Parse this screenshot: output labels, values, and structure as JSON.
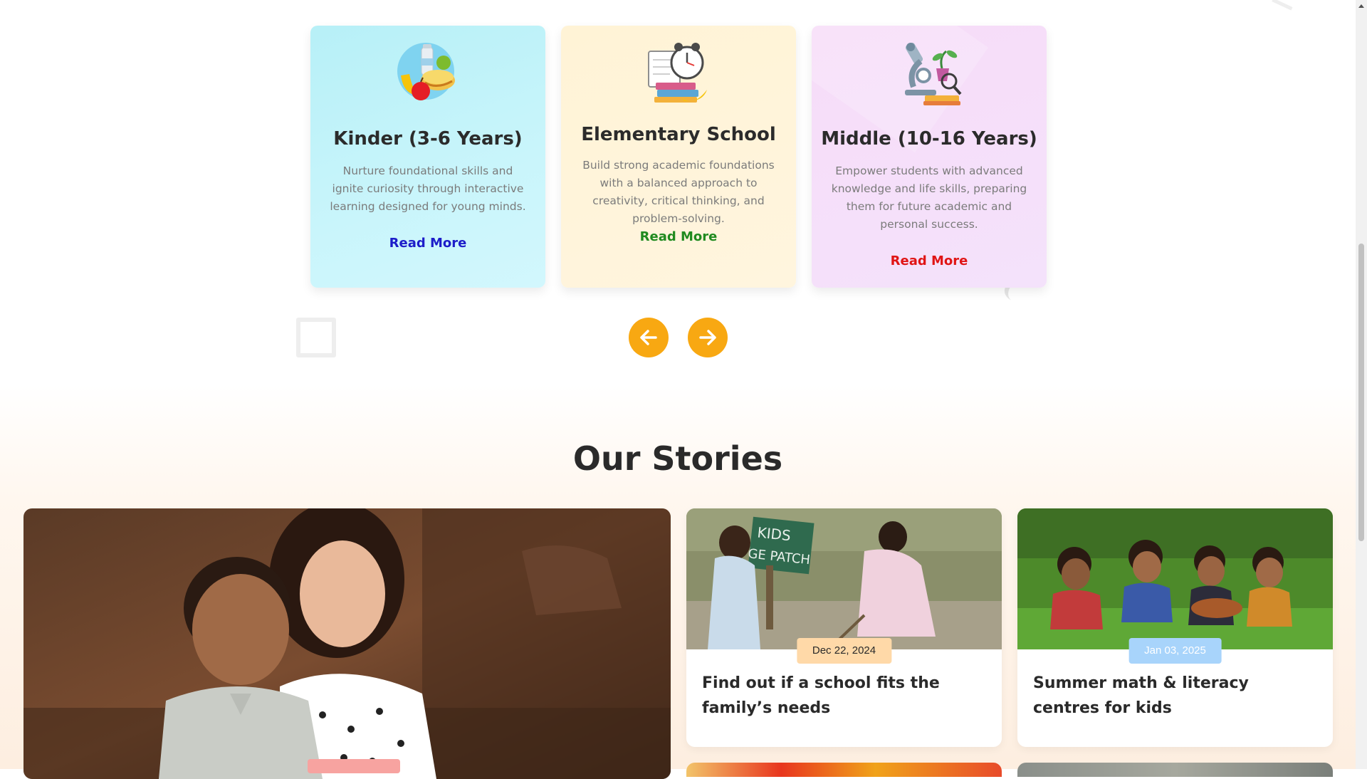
{
  "programs": [
    {
      "title": "Kinder (3-6 Years)",
      "description": "Nurture foundational skills and ignite curiosity through interactive learning designed for young minds.",
      "link": "Read More",
      "link_color": "#1d1dc9",
      "icon": "lunch-food-icon"
    },
    {
      "title": "Elementary School",
      "description": "Build strong academic foundations with a balanced approach to creativity, critical thinking, and problem-solving.",
      "link": "Read More",
      "link_color": "#1f8a1f",
      "icon": "alarm-clock-books-icon"
    },
    {
      "title": "Middle (10-16 Years)",
      "description": "Empower students with advanced knowledge and life skills, preparing them for future academic and personal success.",
      "link": "Read More",
      "link_color": "#e01515",
      "icon": "microscope-icon"
    }
  ],
  "slider": {
    "prev_icon": "arrow-left-icon",
    "next_icon": "arrow-right-icon",
    "accent": "#f8a812"
  },
  "stories": {
    "title": "Our Stories",
    "featured": {
      "image": "children-hugging-photo"
    },
    "cards": [
      {
        "date": "Dec 22, 2024",
        "title": "Find out if a school fits the family’s needs",
        "badge_color": "#ffd9a8",
        "image": "kids-garden-patch-photo"
      },
      {
        "date": "Jan 03, 2025",
        "title": "Summer math & literacy centres for kids",
        "badge_color": "#a8d4fb",
        "image": "boys-in-grass-photo"
      }
    ]
  }
}
